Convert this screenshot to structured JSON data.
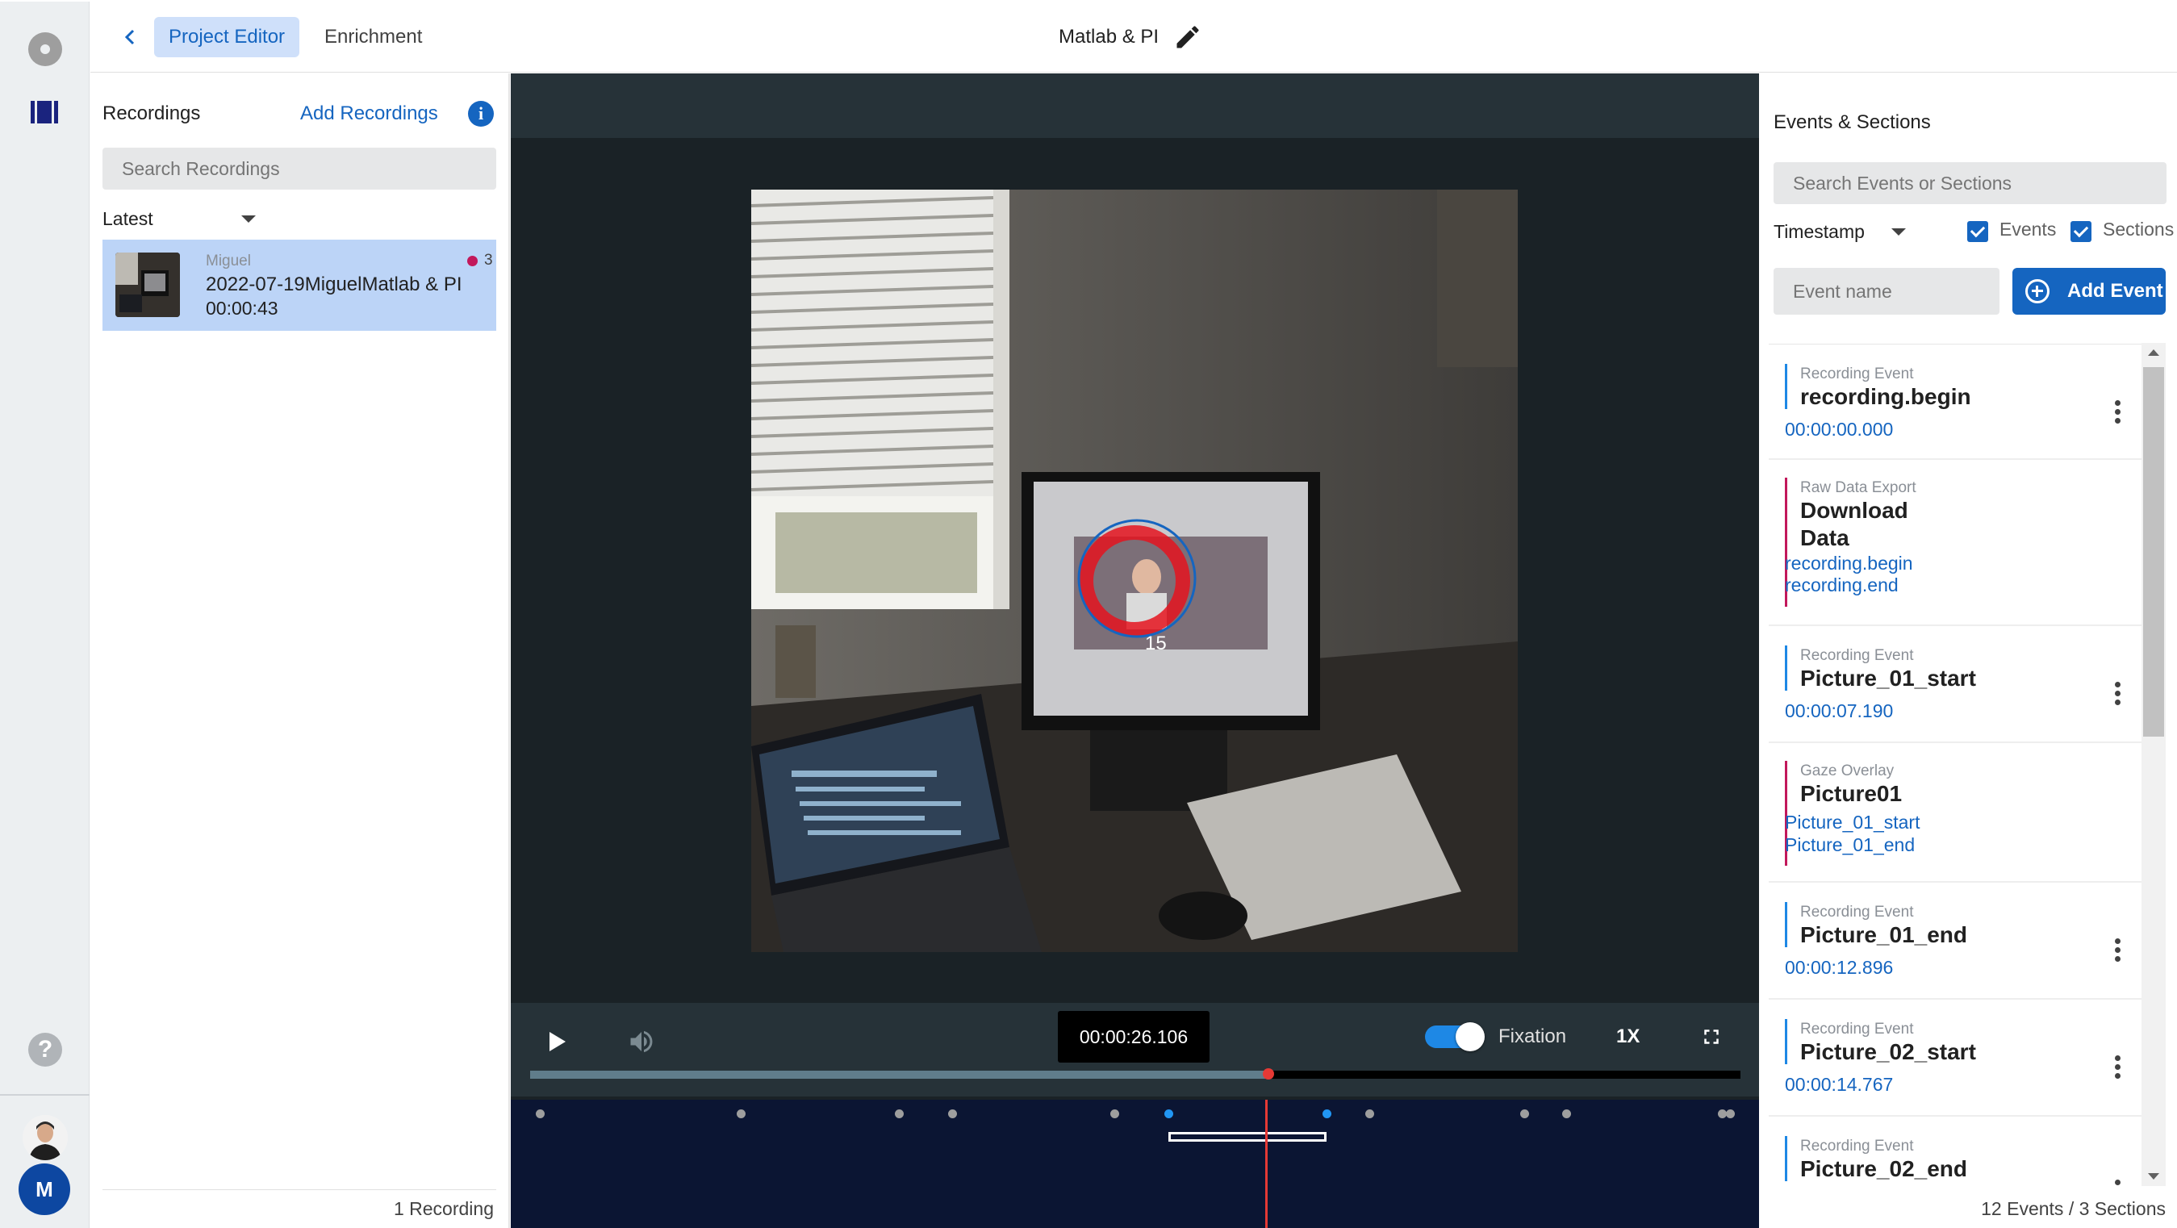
{
  "header": {
    "back_icon": "chevron-left-icon",
    "tabs": [
      "Project Editor",
      "Enrichment"
    ],
    "active_tab": "Project Editor",
    "project_title": "Matlab & PI",
    "edit_icon": "pencil-icon"
  },
  "rail": {
    "icons": [
      "record-icon",
      "library-icon",
      "help-icon"
    ],
    "help_glyph": "?",
    "user_initial": "M"
  },
  "recordings": {
    "title": "Recordings",
    "add_label": "Add Recordings",
    "info_glyph": "i",
    "search_placeholder": "Search Recordings",
    "sort_value": "Latest",
    "items": [
      {
        "owner": "Miguel",
        "name": "2022-07-19MiguelMatlab & PI",
        "duration": "00:00:43",
        "event_count": "3"
      }
    ],
    "footer": "1 Recording"
  },
  "player": {
    "fixation_number": "15",
    "current_time": "00:00:26.106",
    "fixation_label": "Fixation",
    "fixation_enabled": true,
    "speed": "1X",
    "progress_fraction": 0.61,
    "timeline": {
      "markers": [
        {
          "pos": 0.016,
          "color": "#9e9e9e"
        },
        {
          "pos": 0.179,
          "color": "#9e9e9e"
        },
        {
          "pos": 0.308,
          "color": "#9e9e9e"
        },
        {
          "pos": 0.351,
          "color": "#9e9e9e"
        },
        {
          "pos": 0.483,
          "color": "#9e9e9e"
        },
        {
          "pos": 0.527,
          "color": "#2196f3"
        },
        {
          "pos": 0.656,
          "color": "#2196f3"
        },
        {
          "pos": 0.691,
          "color": "#9e9e9e"
        },
        {
          "pos": 0.817,
          "color": "#9e9e9e"
        },
        {
          "pos": 0.851,
          "color": "#9e9e9e"
        },
        {
          "pos": 0.978,
          "color": "#9e9e9e"
        },
        {
          "pos": 0.984,
          "color": "#9e9e9e"
        }
      ],
      "section": {
        "start": 0.527,
        "end": 0.656
      },
      "playhead": 0.607
    }
  },
  "events": {
    "title": "Events & Sections",
    "search_placeholder": "Search Events or Sections",
    "sort_value": "Timestamp",
    "filter_events_label": "Events",
    "filter_sections_label": "Sections",
    "event_name_placeholder": "Event name",
    "add_event_label": "Add Event",
    "items": [
      {
        "kind": "event",
        "type": "Recording Event",
        "name": "recording.begin",
        "time": "00:00:00.000",
        "color": "#1e88e5"
      },
      {
        "kind": "section",
        "type": "Raw Data Export",
        "name": "Download Data",
        "links": [
          "recording.begin",
          "recording.end"
        ],
        "color": "#c2185b"
      },
      {
        "kind": "event",
        "type": "Recording Event",
        "name": "Picture_01_start",
        "time": "00:00:07.190",
        "color": "#1e88e5"
      },
      {
        "kind": "section",
        "type": "Gaze Overlay",
        "name": "Picture01",
        "links": [
          "Picture_01_start",
          "Picture_01_end"
        ],
        "color": "#c2185b"
      },
      {
        "kind": "event",
        "type": "Recording Event",
        "name": "Picture_01_end",
        "time": "00:00:12.896",
        "color": "#1e88e5"
      },
      {
        "kind": "event",
        "type": "Recording Event",
        "name": "Picture_02_start",
        "time": "00:00:14.767",
        "color": "#1e88e5"
      },
      {
        "kind": "event",
        "type": "Recording Event",
        "name": "Picture_02_end",
        "time": "",
        "color": "#1e88e5"
      }
    ],
    "footer": "12 Events / 3 Sections"
  }
}
